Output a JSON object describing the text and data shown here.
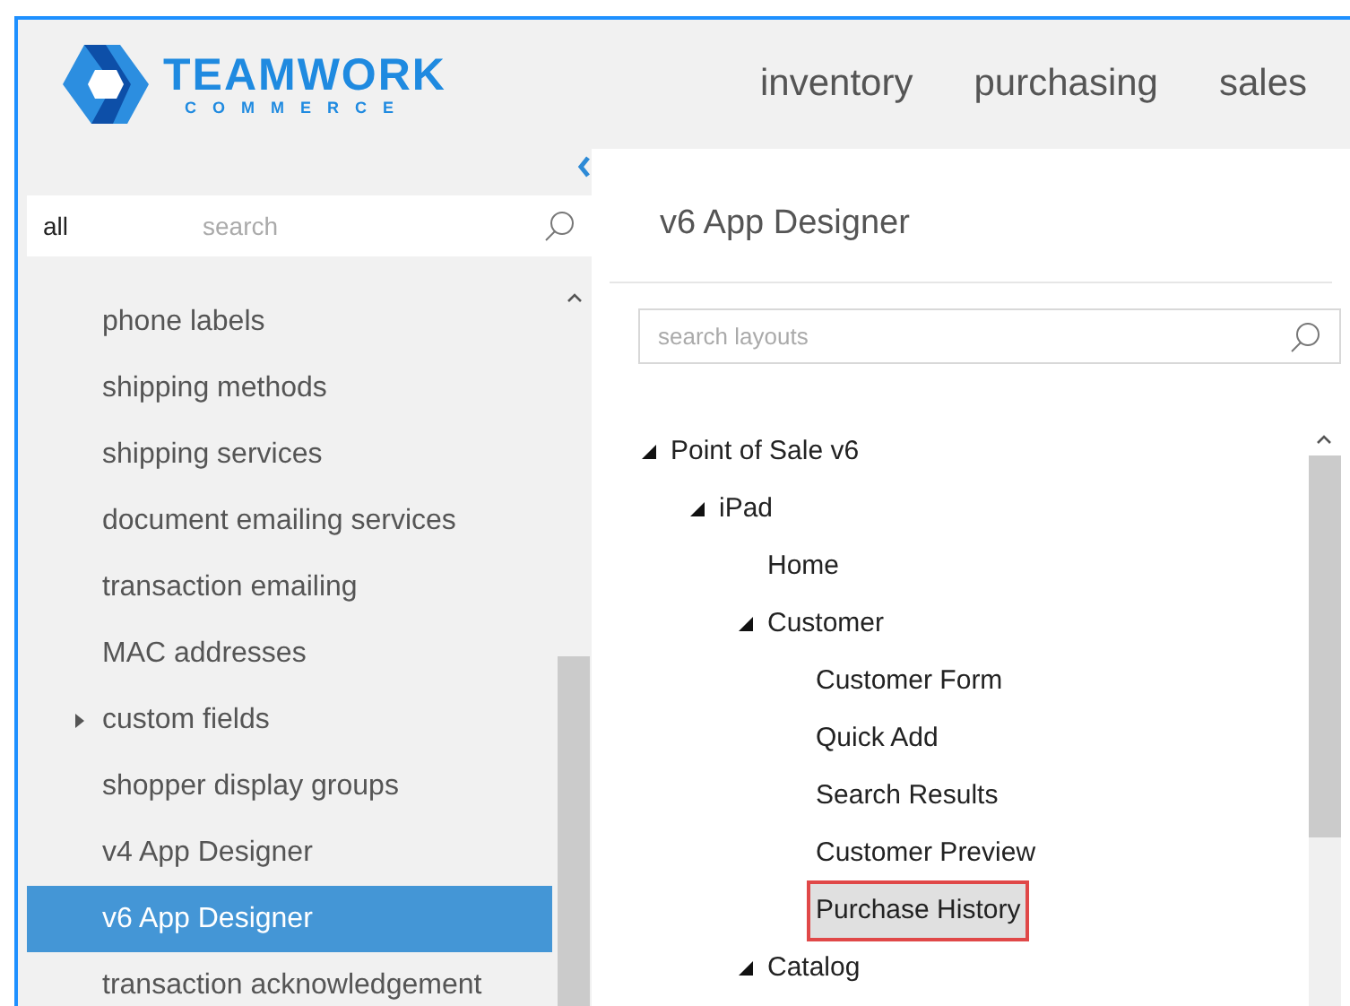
{
  "logo": {
    "name": "TEAMWORK",
    "tagline": "COMMERCE"
  },
  "nav": [
    {
      "label": "inventory"
    },
    {
      "label": "purchasing"
    },
    {
      "label": "sales"
    }
  ],
  "sidebar": {
    "search": {
      "filter": "all",
      "placeholder": "search"
    },
    "items": [
      {
        "label": "phone labels",
        "kind": "leaf",
        "selected": false
      },
      {
        "label": "shipping methods",
        "kind": "leaf",
        "selected": false
      },
      {
        "label": "shipping services",
        "kind": "leaf",
        "selected": false
      },
      {
        "label": "document emailing services",
        "kind": "leaf",
        "selected": false
      },
      {
        "label": "transaction emailing",
        "kind": "leaf",
        "selected": false
      },
      {
        "label": "MAC addresses",
        "kind": "leaf",
        "selected": false
      },
      {
        "label": "custom fields",
        "kind": "group",
        "selected": false
      },
      {
        "label": "shopper display groups",
        "kind": "leaf",
        "selected": false
      },
      {
        "label": "v4 App Designer",
        "kind": "leaf",
        "selected": false
      },
      {
        "label": "v6 App Designer",
        "kind": "leaf",
        "selected": true
      },
      {
        "label": "transaction acknowledgement",
        "kind": "leaf",
        "selected": false
      }
    ]
  },
  "main": {
    "title": "v6 App Designer",
    "search": {
      "placeholder": "search layouts"
    },
    "tree": [
      {
        "label": "Point of Sale v6",
        "expanded": true,
        "selected": false,
        "children": [
          {
            "label": "iPad",
            "expanded": true,
            "selected": false,
            "children": [
              {
                "label": "Home",
                "selected": false
              },
              {
                "label": "Customer",
                "expanded": true,
                "selected": false,
                "children": [
                  {
                    "label": "Customer Form",
                    "selected": false
                  },
                  {
                    "label": "Quick Add",
                    "selected": false
                  },
                  {
                    "label": "Search Results",
                    "selected": false
                  },
                  {
                    "label": "Customer Preview",
                    "selected": false
                  },
                  {
                    "label": "Purchase History",
                    "selected": true
                  }
                ]
              },
              {
                "label": "Catalog",
                "expanded": true,
                "selected": false
              }
            ]
          }
        ]
      }
    ]
  }
}
